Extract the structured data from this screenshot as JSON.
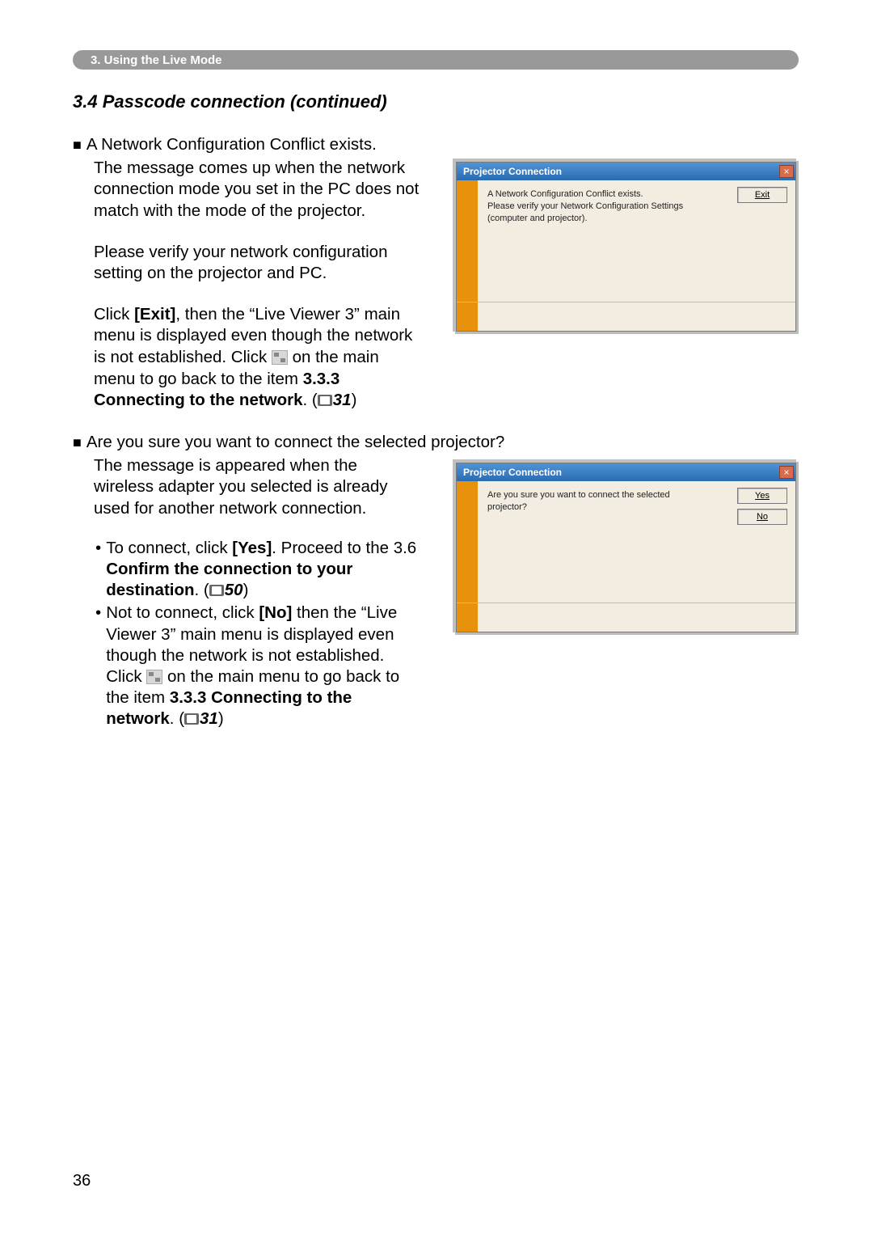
{
  "section_bar": "3. Using the Live Mode",
  "heading": "3.4 Passcode connection (continued)",
  "block1": {
    "bullet_title": "A Network Configuration Conflict exists.",
    "p1": "The message comes up when the network connection mode you set in the PC does not match with the mode of the projector.",
    "p2": "Please verify your network configuration setting on the projector and PC.",
    "p3_pre": "Click ",
    "p3_exit": "[Exit]",
    "p3_mid": ", then the “Live Viewer 3” main menu is displayed even though the network is not established. Click ",
    "p3_post": " on the main menu to go back to the item ",
    "p3_ref_label": "3.3.3 Connecting to the network",
    "p3_ref_page": "31"
  },
  "block2": {
    "bullet_title": "Are you sure you want to connect the selected projector?",
    "p1": "The message is appeared when the wireless adapter you selected is already used for another network connection.",
    "li1_pre": "To connect, click ",
    "li1_yes": "[Yes]",
    "li1_mid": ". Proceed to the 3.6 ",
    "li1_ref_label": "Confirm the connection to your destination",
    "li1_ref_page": "50",
    "li2_pre": "Not to connect, click ",
    "li2_no": "[No]",
    "li2_mid": " then the “Live Viewer 3” main menu is displayed even though the network is not established. Click ",
    "li2_post": " on the main menu to go back to the item ",
    "li2_ref_label": "3.3.3 Connecting to the network",
    "li2_ref_page": "31"
  },
  "dialog1": {
    "title": "Projector Connection",
    "msg": "A Network Configuration Conflict exists.\nPlease verify your Network Configuration Settings (computer and projector).",
    "btn_exit": "Exit"
  },
  "dialog2": {
    "title": "Projector Connection",
    "msg": "Are you sure you want to connect the selected projector?",
    "btn_yes": "Yes",
    "btn_no": "No"
  },
  "page_number": "36"
}
